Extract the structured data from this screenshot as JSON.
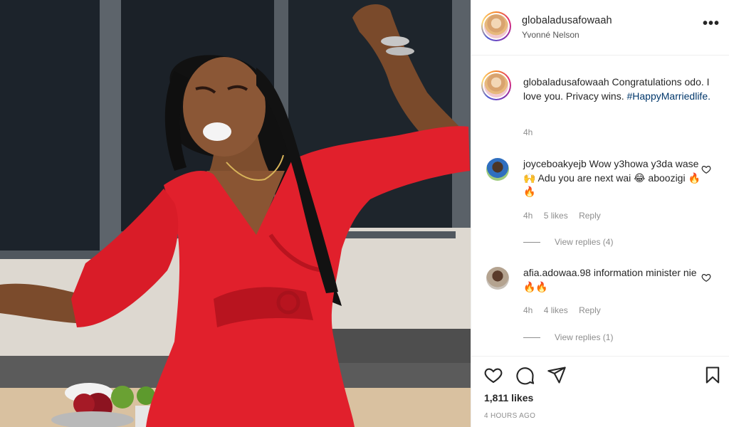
{
  "header": {
    "username": "globaladusafowaah",
    "subtitle": "Yvonné Nelson",
    "more_icon": "more-options-icon"
  },
  "caption": {
    "username": "globaladusafowaah",
    "text": "Congratulations odo. I love you. Privacy wins.",
    "hashtag": "#HappyMarriedlife.",
    "time": "4h"
  },
  "comments": [
    {
      "username": "joyceboakyejb",
      "text": "Wow y3howa y3da wase 🙌 Adu you are next wai 😂 aboozigi 🔥🔥",
      "time": "4h",
      "likes": "5 likes",
      "reply": "Reply",
      "view_replies": "View replies (4)"
    },
    {
      "username": "afia.adowaa.98",
      "text": "information minister nie🔥🔥",
      "time": "4h",
      "likes": "4 likes",
      "reply": "Reply",
      "view_replies": "View replies (1)"
    }
  ],
  "footer": {
    "likes": "1,811 likes",
    "posted": "4 HOURS AGO"
  },
  "icons": [
    "heart-icon",
    "comment-icon",
    "share-icon",
    "bookmark-icon"
  ],
  "colors": {
    "hashtag": "#00376b",
    "muted": "#8e8e8e",
    "dress": "#e0202c"
  }
}
